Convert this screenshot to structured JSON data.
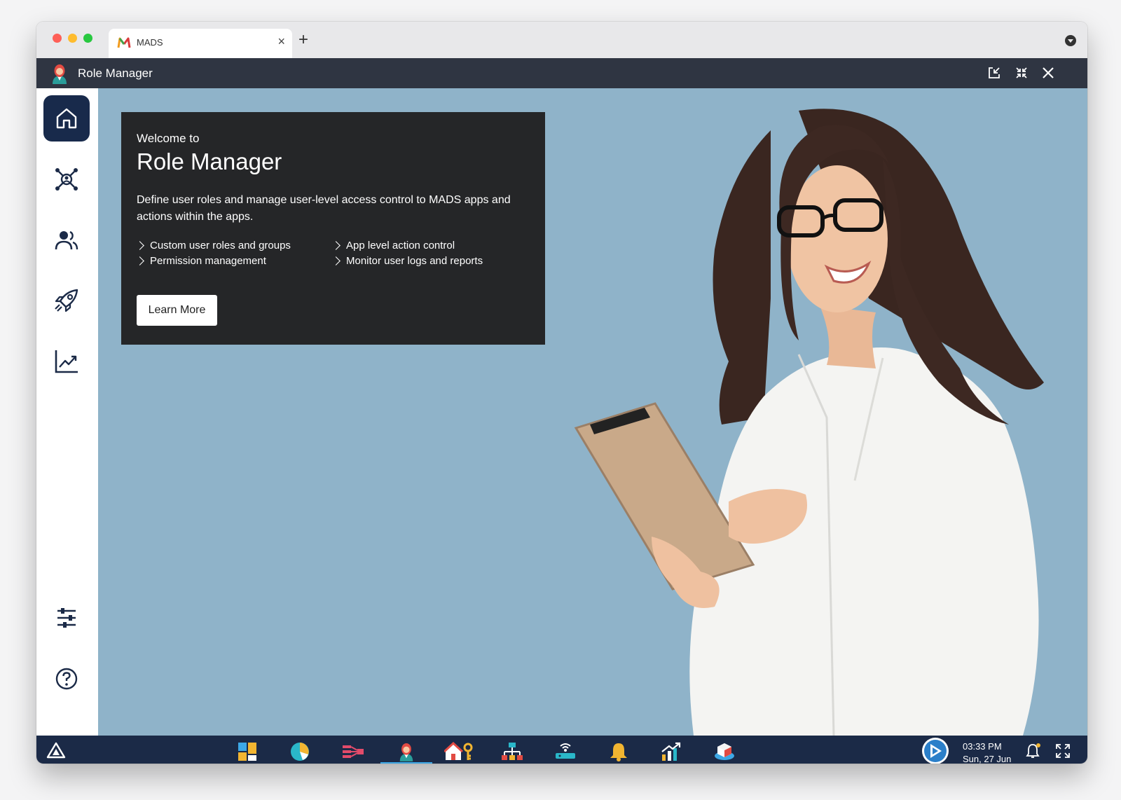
{
  "browser": {
    "tab_title": "MADS",
    "tab_close_icon": "close-icon",
    "new_tab_icon": "plus-icon"
  },
  "app": {
    "title": "Role Manager",
    "header_actions": [
      "popout-icon",
      "collapse-icon",
      "close-icon"
    ]
  },
  "sidebar": {
    "items": [
      {
        "name": "home",
        "icon": "home-icon",
        "active": true
      },
      {
        "name": "network",
        "icon": "network-icon"
      },
      {
        "name": "users",
        "icon": "users-icon"
      },
      {
        "name": "launch",
        "icon": "rocket-icon"
      },
      {
        "name": "analytics",
        "icon": "chart-icon"
      }
    ],
    "bottom_items": [
      {
        "name": "settings",
        "icon": "sliders-icon"
      },
      {
        "name": "help",
        "icon": "help-icon"
      }
    ]
  },
  "welcome_card": {
    "subtitle": "Welcome to",
    "title": "Role Manager",
    "description": "Define user roles and manage user-level access control to MADS apps and actions within the apps.",
    "features": [
      "Custom user roles and groups",
      "App level action control",
      "Permission management",
      "Monitor user logs and reports"
    ],
    "button_label": "Learn More"
  },
  "taskbar": {
    "apps": [
      {
        "name": "dashboard",
        "icon": "tiles-icon"
      },
      {
        "name": "analytics",
        "icon": "pie-chart-icon"
      },
      {
        "name": "flows",
        "icon": "flow-icon"
      },
      {
        "name": "role-manager",
        "icon": "person-icon",
        "active": true
      },
      {
        "name": "home-access",
        "icon": "home-key-icon"
      },
      {
        "name": "org",
        "icon": "hierarchy-icon"
      },
      {
        "name": "devices",
        "icon": "router-icon"
      },
      {
        "name": "alerts",
        "icon": "bell-icon"
      },
      {
        "name": "reports",
        "icon": "growth-chart-icon"
      },
      {
        "name": "packages",
        "icon": "cube-icon"
      }
    ],
    "time": "03:33 PM",
    "date": "Sun, 27 Jun"
  },
  "colors": {
    "appbar": "#2f3542",
    "sidebar_active": "#182a4b",
    "background": "#8fb3c9",
    "card": "#252628",
    "taskbar": "#1b2a47"
  }
}
